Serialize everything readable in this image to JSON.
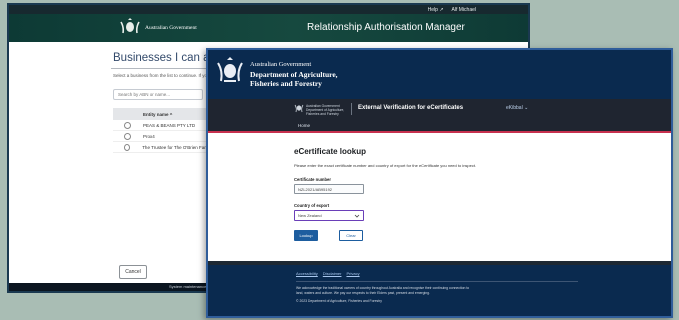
{
  "ram": {
    "topbar": {
      "help": "Help ↗",
      "user": "Alf Michael"
    },
    "header": {
      "gov": "Australian Government",
      "app_title": "Relationship Authorisation Manager"
    },
    "page_title": "Businesses I can act for",
    "intro": "Select a business from the list to continue. If you",
    "search": {
      "placeholder": "Search by ABN or name..."
    },
    "table": {
      "header": "Entity name ^",
      "rows": [
        {
          "name": "PEAS & BEANS PTY LTD"
        },
        {
          "name": "Prox4"
        },
        {
          "name": "The Trustee for The O'Brien Fami"
        }
      ]
    },
    "cancel_label": "Cancel",
    "footer_text": "System maintenance"
  },
  "ec": {
    "brand": {
      "gov": "Australian Government",
      "dept_line1": "Department of Agriculture,",
      "dept_line2": "Fisheries and Forestry"
    },
    "appbar": {
      "gov_line1": "Australian Government",
      "gov_line2": "Department of Agriculture,",
      "gov_line3": "Fisheries and Forestry",
      "title": "External Verification for eCertificates",
      "user": "eKibbal ⌄"
    },
    "nav": {
      "home": "Home"
    },
    "main": {
      "title": "eCertificate lookup",
      "intro": "Please enter the exact certificate number and country of export for the eCertificate you need to inspect.",
      "cert_label": "Certificate number",
      "cert_value": "NZL2021/AB95192",
      "country_label": "Country of export",
      "country_value": "New Zealand",
      "lookup_label": "Lookup",
      "clear_label": "Clear"
    },
    "footer": {
      "links": [
        "Accessibility",
        "Disclaimer",
        "Privacy"
      ],
      "ack": "We acknowledge the traditional owners of country throughout Australia and recognise their continuing connection to land, waters and culture. We pay our respects to their Elders past, present and emerging.",
      "copyright": "© 2023 Department of Agriculture, Fisheries and Forestry"
    }
  },
  "colors": {
    "background": "#a9bdb4",
    "ram_header": "#16493f",
    "ec_brand": "#0a2a4f",
    "ec_appbar": "#1f2530",
    "ec_accent_red": "#c7314f",
    "ec_primary": "#1d5d9f",
    "ec_focus": "#6a3fb8"
  },
  "icons": [
    "coat-of-arms-icon",
    "radio-icon",
    "chevron-down-icon"
  ]
}
